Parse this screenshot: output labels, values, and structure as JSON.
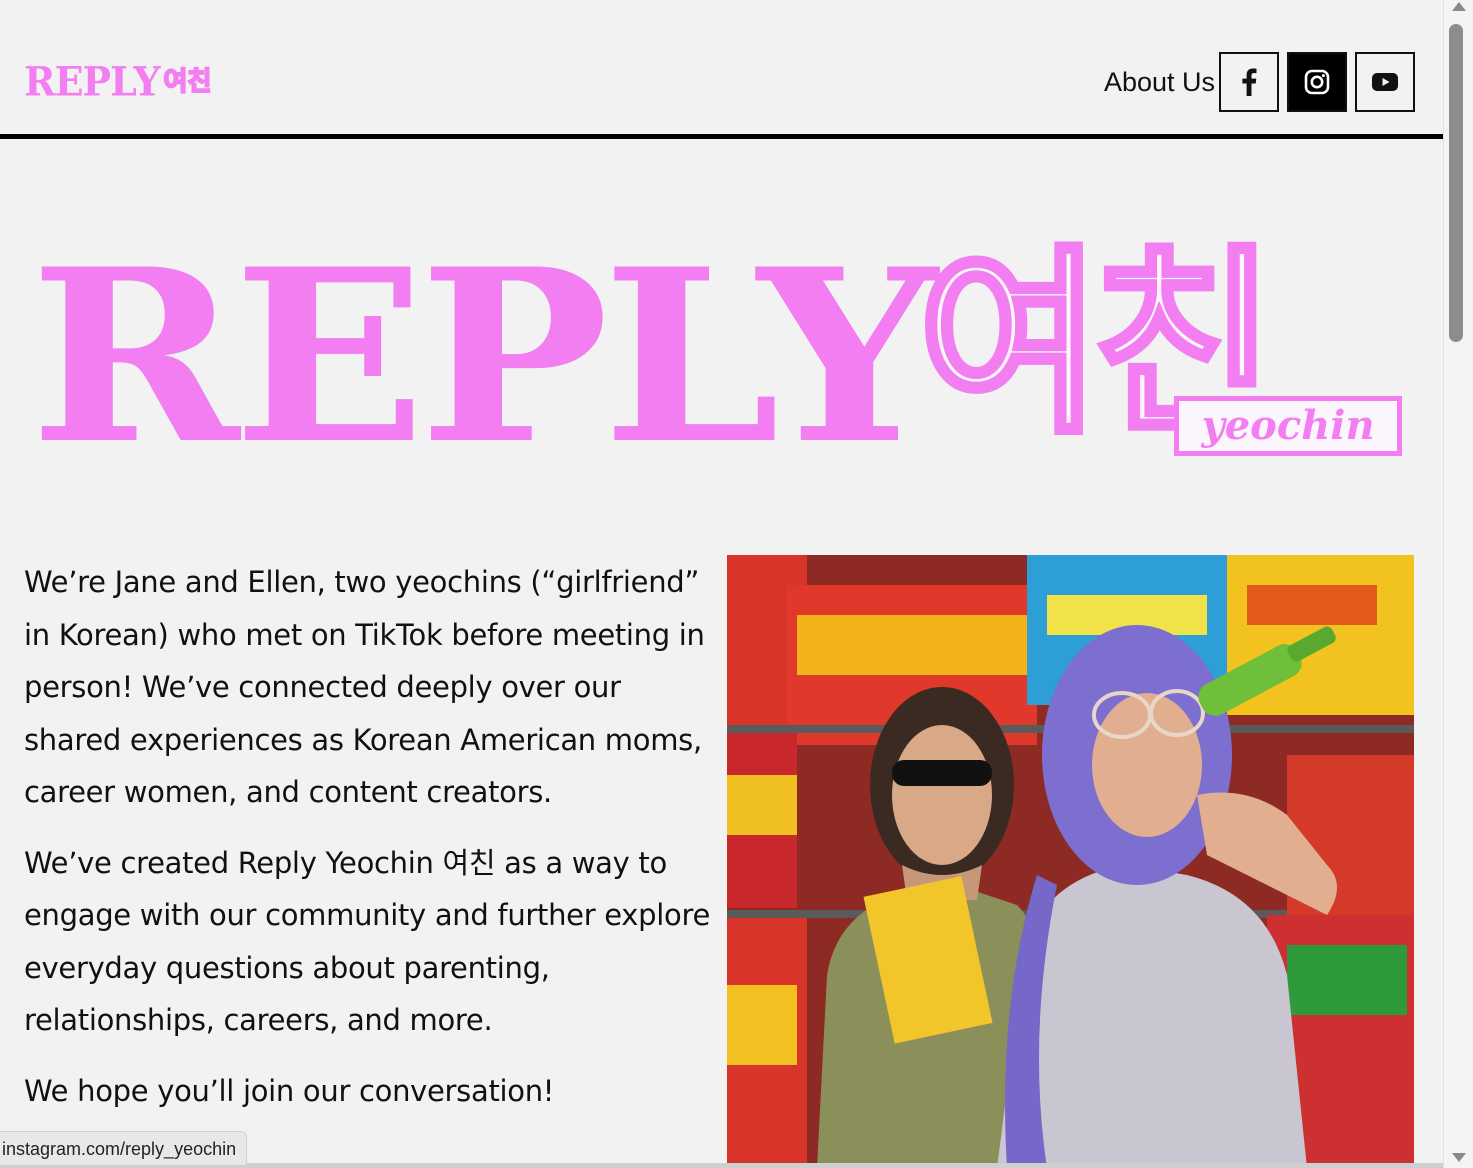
{
  "header": {
    "logo_word": "REPLY",
    "logo_korean": "여친",
    "nav": {
      "about_label": "About Us",
      "social": [
        {
          "icon": "facebook-icon",
          "style": "outline"
        },
        {
          "icon": "instagram-icon",
          "style": "filled"
        },
        {
          "icon": "youtube-icon",
          "style": "outline"
        }
      ]
    }
  },
  "hero": {
    "word": "REPLY",
    "korean": "여친",
    "subtitle": "yeochin"
  },
  "main": {
    "paragraphs": [
      "We’re Jane and Ellen, two yeochins (“girlfriend” in Korean) who met on TikTok before meeting in person! We’ve connected deeply over our shared experiences as Korean American moms, career women, and content creators.",
      "We’ve created Reply Yeochin 여친 as a way to engage with our community and further explore everyday questions about parenting, relationships, careers, and more.",
      "We hope you’ll join our conversation!"
    ]
  },
  "status_bar": {
    "url": "instagram.com/reply_yeochin"
  },
  "colors": {
    "brand_pink": "#f27ef2",
    "background": "#f2f2f2",
    "text": "#111111"
  }
}
